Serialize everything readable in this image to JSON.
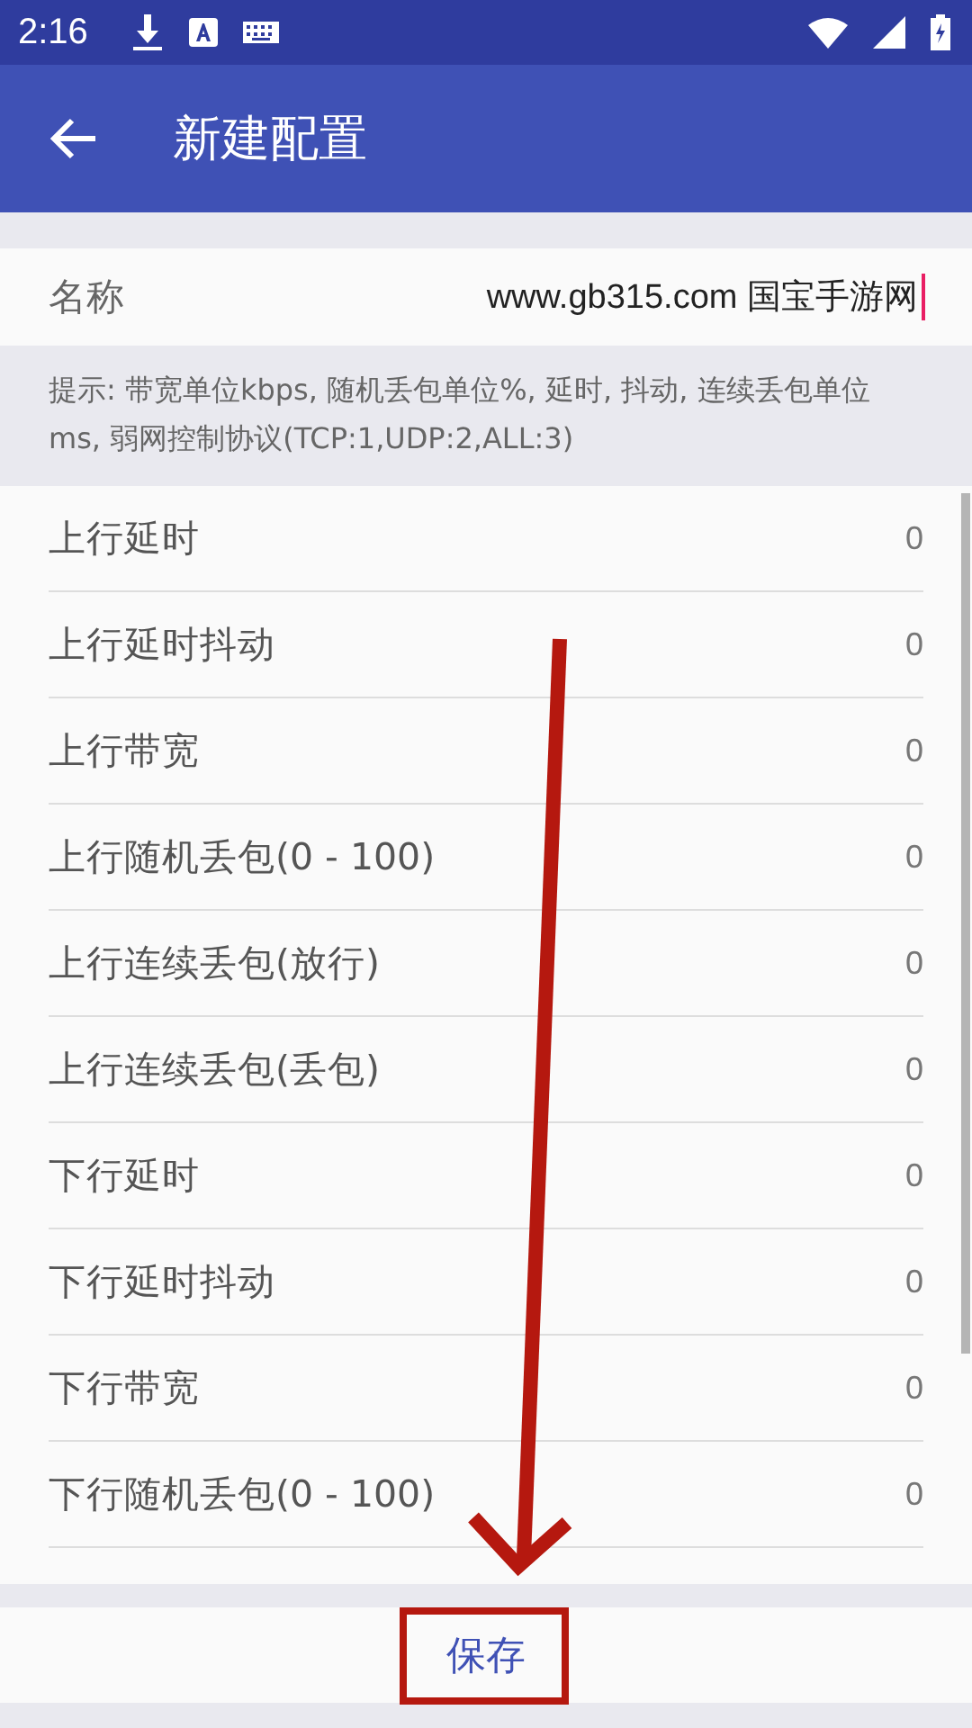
{
  "status_bar": {
    "time": "2:16"
  },
  "app_bar": {
    "title": "新建配置"
  },
  "name_field": {
    "label": "名称",
    "value": "www.gb315.com 国宝手游网",
    "focused": true
  },
  "hint": "提示: 带宽单位kbps, 随机丢包单位%, 延时, 抖动, 连续丢包单位ms, 弱网控制协议(TCP:1,UDP:2,ALL:3)",
  "settings": [
    {
      "label": "上行延时",
      "value": "0"
    },
    {
      "label": "上行延时抖动",
      "value": "0"
    },
    {
      "label": "上行带宽",
      "value": "0"
    },
    {
      "label": "上行随机丢包(0 - 100)",
      "value": "0"
    },
    {
      "label": "上行连续丢包(放行)",
      "value": "0"
    },
    {
      "label": "上行连续丢包(丢包)",
      "value": "0"
    },
    {
      "label": "下行延时",
      "value": "0"
    },
    {
      "label": "下行延时抖动",
      "value": "0"
    },
    {
      "label": "下行带宽",
      "value": "0"
    },
    {
      "label": "下行随机丢包(0 - 100)",
      "value": "0"
    }
  ],
  "save_button": {
    "label": "保存"
  }
}
